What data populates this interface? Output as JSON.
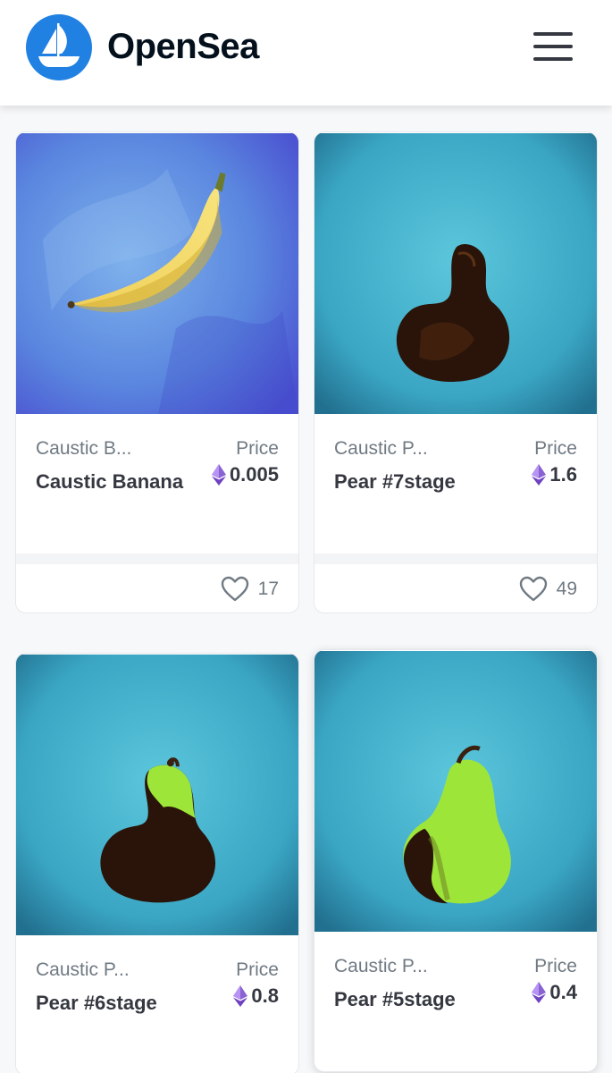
{
  "header": {
    "brand": "OpenSea",
    "logo_icon": "opensea-ship-icon",
    "menu_icon": "hamburger-menu-icon",
    "accent_color": "#2081e2"
  },
  "cards": [
    {
      "collection": "Caustic B...",
      "title": "Caustic Banana",
      "price_label": "Price",
      "price": "0.005",
      "likes": "17",
      "image": "banana-artwork"
    },
    {
      "collection": "Caustic P...",
      "title": "Pear #7stage",
      "price_label": "Price",
      "price": "1.6",
      "likes": "49",
      "image": "rotten-pear-artwork"
    },
    {
      "collection": "Caustic P...",
      "title": "Pear #6stage",
      "price_label": "Price",
      "price": "0.8",
      "image": "half-rotten-pear-artwork"
    },
    {
      "collection": "Caustic P...",
      "title": "Pear #5stage",
      "price_label": "Price",
      "price": "0.4",
      "image": "ripening-pear-artwork"
    }
  ]
}
